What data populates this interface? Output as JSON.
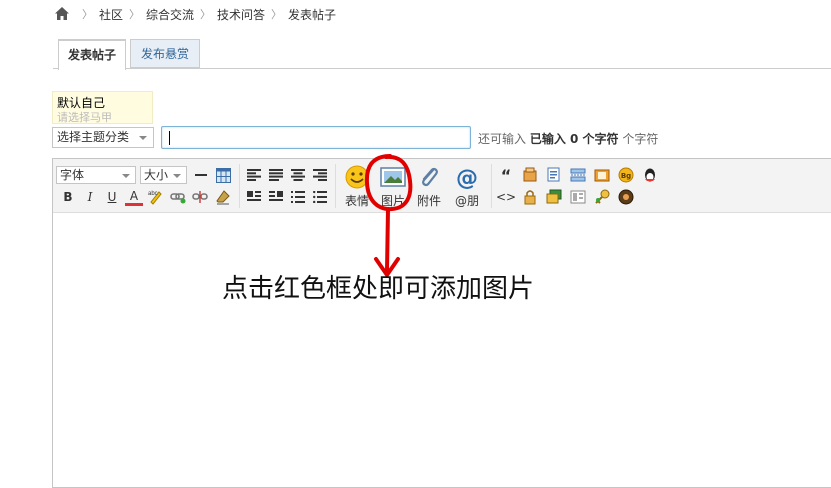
{
  "breadcrumb": {
    "home_icon": "home-icon",
    "items": [
      "社区",
      "综合交流",
      "技术问答",
      "发表帖子"
    ]
  },
  "tabs": [
    {
      "label": "发表帖子",
      "active": true
    },
    {
      "label": "发布悬赏",
      "active": false
    }
  ],
  "user_select": {
    "current": "默认自己",
    "hint": "请选择马甲"
  },
  "topic_select": {
    "value": "选择主题分类"
  },
  "subject": {
    "value": "",
    "counter_prefix": "还可输入",
    "counter_bold": "已输入 0 个字符",
    "counter_suffix": "个字符"
  },
  "toolbar": {
    "font_label": "字体",
    "size_label": "大小",
    "big_buttons": {
      "emoji": "表情",
      "image": "图片",
      "attach": "附件",
      "mention": "@朋"
    },
    "small_buttons": {
      "bold": "B",
      "italic": "I",
      "underline": "U",
      "forecolor": "A",
      "quote": "“",
      "code": "<>"
    }
  },
  "annotation": "点击红色框处即可添加图片",
  "colors": {
    "annotation_red": "#e00000",
    "tab_inactive_bg": "#e7eef5",
    "tab_inactive_text": "#336699",
    "input_border": "#7eb3d8"
  }
}
